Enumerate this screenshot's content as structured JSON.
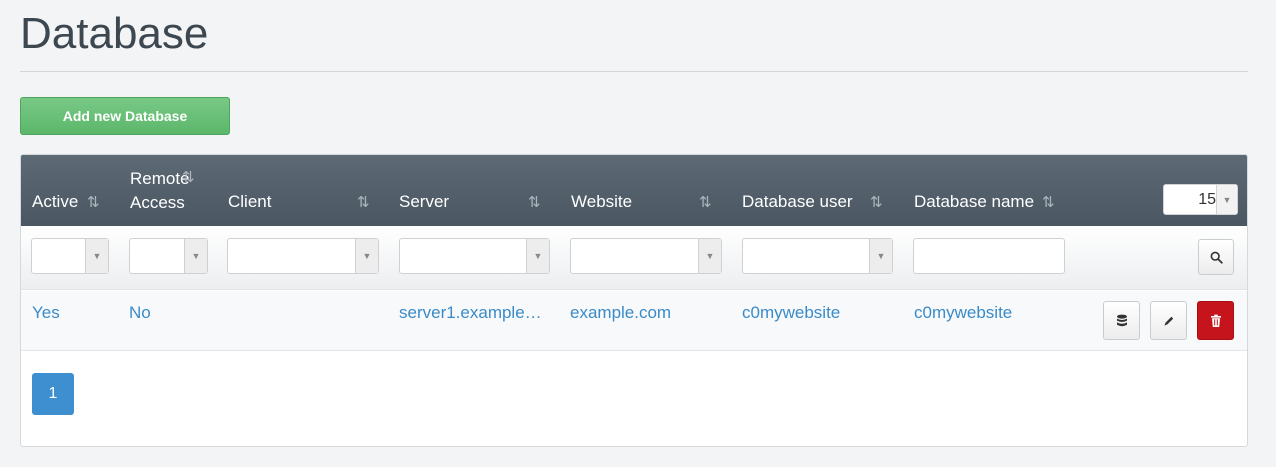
{
  "page": {
    "title": "Database"
  },
  "toolbar": {
    "add_label": "Add new Database"
  },
  "table": {
    "columns": [
      {
        "line1": "Active",
        "line2": ""
      },
      {
        "line1": "Remote",
        "line2": "Access"
      },
      {
        "line1": "Client",
        "line2": ""
      },
      {
        "line1": "Server",
        "line2": ""
      },
      {
        "line1": "Website",
        "line2": ""
      },
      {
        "line1": "Database user",
        "line2": ""
      },
      {
        "line1": "Database name",
        "line2": ""
      }
    ],
    "sort_glyph": "⇅",
    "page_size": "15",
    "rows": [
      {
        "active": "Yes",
        "remote_access": "No",
        "client": "",
        "server": "server1.example…",
        "website": "example.com",
        "database_user": "c0mywebsite",
        "database_name": "c0mywebsite"
      }
    ]
  },
  "pagination": {
    "current": "1"
  },
  "icons": {
    "search": "search-icon",
    "database": "database-icon",
    "edit": "pencil-icon",
    "delete": "trash-icon"
  },
  "colors": {
    "primary": "#3d8fd0",
    "success": "#5cb76a",
    "danger": "#c5141c",
    "header": "#4e5a65",
    "link": "#3a8bc8"
  }
}
